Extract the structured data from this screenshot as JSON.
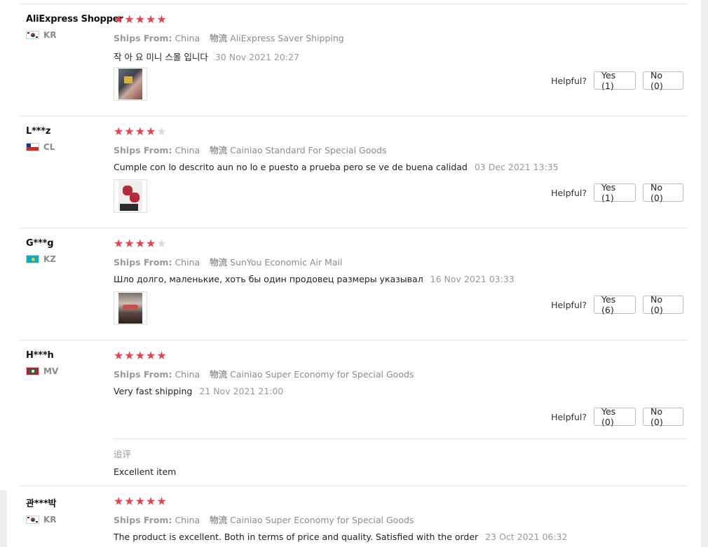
{
  "reviews": [
    {
      "user": "AliExpress Shopper",
      "country": "KR",
      "rating": 5,
      "ships_from_label": "Ships From:",
      "ships_from": "China",
      "logistics_label": "物流",
      "logistics": "AliExpress Saver Shipping",
      "comment": "작 아 요 미니 스몰 입니다",
      "date": "30 Nov 2021 20:27",
      "has_photo": true,
      "helpful_label": "Helpful?",
      "yes": "Yes (1)",
      "no": "No (0)"
    },
    {
      "user": "L***z",
      "country": "CL",
      "rating": 4,
      "ships_from_label": "Ships From:",
      "ships_from": "China",
      "logistics_label": "物流",
      "logistics": "Cainiao Standard For Special Goods",
      "comment": "Cumple con lo descrito aun no lo e puesto a prueba pero se ve de buena calidad",
      "date": "03 Dec 2021 13:35",
      "has_photo": true,
      "helpful_label": "Helpful?",
      "yes": "Yes (1)",
      "no": "No (0)"
    },
    {
      "user": "G***g",
      "country": "KZ",
      "rating": 4,
      "ships_from_label": "Ships From:",
      "ships_from": "China",
      "logistics_label": "物流",
      "logistics": "SunYou Economic Air Mail",
      "comment": "Шло долго, маленькие, хоть бы один продовец размеры указывал",
      "date": "16 Nov 2021 03:33",
      "has_photo": true,
      "helpful_label": "Helpful?",
      "yes": "Yes (6)",
      "no": "No (0)"
    },
    {
      "user": "H***h",
      "country": "MV",
      "rating": 5,
      "ships_from_label": "Ships From:",
      "ships_from": "China",
      "logistics_label": "物流",
      "logistics": "Cainiao Super Economy for Special Goods",
      "comment": "Very fast shipping",
      "date": "21 Nov 2021 21:00",
      "has_photo": false,
      "helpful_label": "Helpful?",
      "yes": "Yes (0)",
      "no": "No (0)",
      "followup_title": "追评",
      "followup_text": "Excellent item"
    },
    {
      "user": "관***박",
      "country": "KR",
      "rating": 5,
      "ships_from_label": "Ships From:",
      "ships_from": "China",
      "logistics_label": "物流",
      "logistics": "Cainiao Super Economy for Special Goods",
      "comment": "The product is excellent. Both in terms of price and quality. Satisfied with the order",
      "date": "23 Oct 2021 06:32",
      "has_photo": false
    }
  ],
  "colors": {
    "star_on": "#e8434b",
    "star_off": "#d8d8d8",
    "muted_text": "#8c8c8c",
    "divider": "#e6e6e6"
  }
}
